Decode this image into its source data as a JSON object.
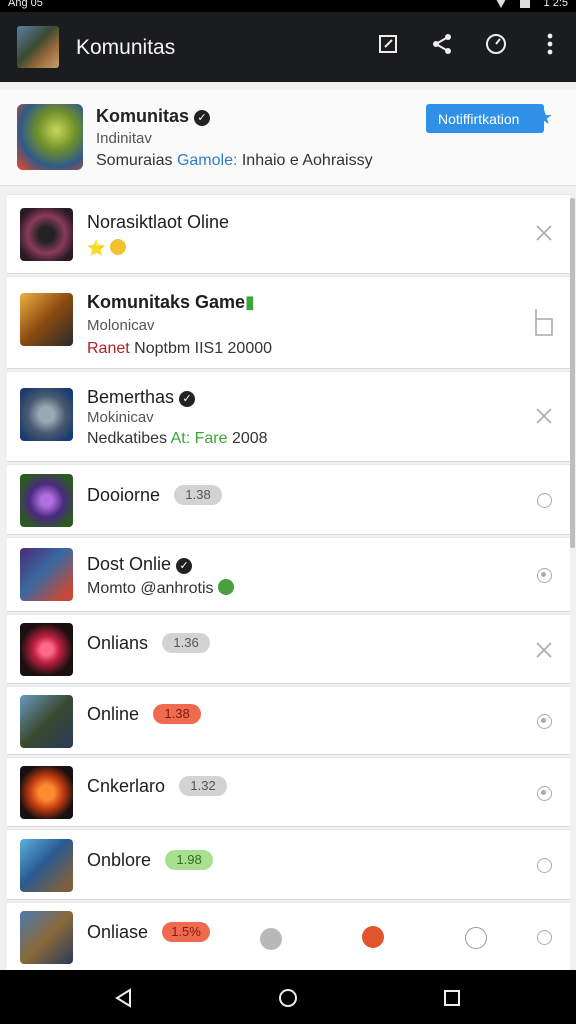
{
  "status_bar": {
    "left": "Ang 05",
    "right": "1 2:5"
  },
  "app_bar": {
    "title": "Komunitas"
  },
  "header": {
    "name": "Komunitas",
    "verified_mark": "✓",
    "subtitle": "Indinitav",
    "description_prefix": "Somuraias",
    "description_accent": "Gamole:",
    "description_suffix": "Inhaio e Aohraissy",
    "button_label": "Notiffirtkation"
  },
  "rows": [
    {
      "title": "Norasiktlaot Oline",
      "emoji": "⭐",
      "control": "close"
    },
    {
      "title": "Komunitaks Game",
      "subtitle": "Molonicav",
      "detail_red": "Ranet",
      "detail_rest": "Noptbm IIS1 20000",
      "control": "bracket"
    },
    {
      "title": "Bemerthas",
      "verified_mark": "✓",
      "subtitle": "Mokinicav",
      "detail_prefix": "Nedkatibes",
      "detail_green": "At: Fare",
      "detail_suffix": "2008",
      "control": "close"
    },
    {
      "title": "Dooiorne",
      "badge": "1.38",
      "badge_style": "gray",
      "control": "circle"
    },
    {
      "title": "Dost Onlie",
      "verified_mark": "✓",
      "detail": "Momto @anhrotis",
      "control": "circle-dot"
    },
    {
      "title": "Onlians",
      "badge": "1.36",
      "badge_style": "gray",
      "control": "close"
    },
    {
      "title": "Online",
      "badge": "1.38",
      "badge_style": "red",
      "control": "circle-dot"
    },
    {
      "title": "Cnkerlaro",
      "badge": "1.32",
      "badge_style": "gray",
      "control": "circle-dot"
    },
    {
      "title": "Onblore",
      "badge": "1.98",
      "badge_style": "green",
      "control": "circle"
    },
    {
      "title": "Onliase",
      "badge": "1.5%",
      "badge_style": "red",
      "control": "circle"
    }
  ],
  "icons": {
    "edit": "edit-icon",
    "share": "share-icon",
    "timer": "timer-icon",
    "more": "more-vert-icon",
    "back": "back-icon",
    "home": "home-icon",
    "recents": "recents-icon"
  },
  "colors": {
    "accent_blue": "#2f90e8",
    "appbar": "#1b1c1e",
    "badge_red": "#ef6a4e",
    "badge_green": "#a9e08f"
  }
}
